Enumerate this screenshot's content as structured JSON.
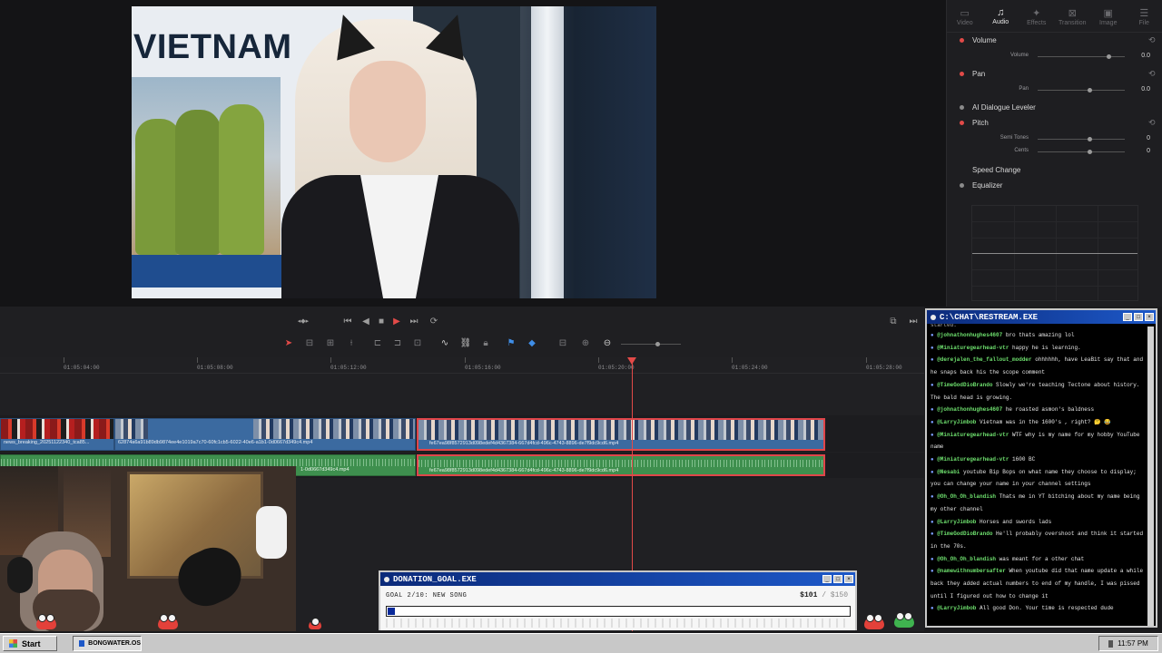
{
  "viewer": {
    "video_title_text": "VIETNAM"
  },
  "inspector": {
    "tabs": [
      {
        "label": "Video",
        "icon": "video-icon"
      },
      {
        "label": "Audio",
        "icon": "music-note-icon"
      },
      {
        "label": "Effects",
        "icon": "effects-icon"
      },
      {
        "label": "Transition",
        "icon": "transition-icon"
      },
      {
        "label": "Image",
        "icon": "image-icon"
      },
      {
        "label": "File",
        "icon": "file-icon"
      }
    ],
    "volume": {
      "title": "Volume",
      "param": "Volume",
      "value": "0.0"
    },
    "pan": {
      "title": "Pan",
      "param": "Pan",
      "value": "0.0"
    },
    "ai_dialogue": {
      "title": "AI Dialogue Leveler"
    },
    "pitch": {
      "title": "Pitch",
      "semi_label": "Semi Tones",
      "semi_value": "0",
      "cents_label": "Cents",
      "cents_value": "0"
    },
    "speed": {
      "title": "Speed Change"
    },
    "equalizer": {
      "title": "Equalizer"
    }
  },
  "timeline": {
    "timecodes": [
      "01:05:04:00",
      "01:05:08:00",
      "01:05:12:00",
      "01:05:16:00",
      "01:05:20:00",
      "01:05:24:00",
      "01:05:28:00"
    ],
    "video_clips": [
      {
        "name": "news_breaking_20251122340_tca85..."
      },
      {
        "name": "62874a6a91b89db9874ee4e1019a7c70-60fc1cb5-6022-40e6-a1b1-0d0667d349c4.mp4"
      },
      {
        "name": "fe67ea98f8572913d098edef4d4367384-667d4fcd-496c-4743-8896-de7f9dc9cd6.mp4"
      }
    ],
    "audio_clips": [
      {
        "name": "1-0d0667d349c4.mp4"
      },
      {
        "name": "fe67ea98f8572913d098edef4d4367384-667d4fcd-496c-4743-8896-de7f9dc9cd6.mp4"
      }
    ]
  },
  "chat": {
    "title": "C:\\CHAT\\RESTREAM.EXE",
    "top_fragment": "started.",
    "messages": [
      {
        "user": "@johnathonhughes4607",
        "text": "bro thats amazing lol"
      },
      {
        "user": "@Miniaturegearhead-vtr",
        "text": "happy he is learning."
      },
      {
        "user": "@derejalen_the_fallout_modder",
        "text": "ohhhhhh, have LeaBit say that and he snaps back his the scope comment"
      },
      {
        "user": "@TimeGodDioBrando",
        "text": "Slowly we're teaching Tectone about history. The bald head is growing."
      },
      {
        "user": "@johnathonhughes4607",
        "text": "he roasted asmon's baldness"
      },
      {
        "user": "@LarryJimbob",
        "text": "Vietnam was in the 1600's , right? 🤔 😂"
      },
      {
        "user": "@Miniaturegearhead-vtr",
        "text": "WTF why is my name for my hobby YouTube name"
      },
      {
        "user": "@Miniaturegearhead-vtr",
        "text": "1600 BC"
      },
      {
        "user": "@Nesabi",
        "text": "youtube Bip Bops on what name they choose to display; you can change your name in your channel settings"
      },
      {
        "user": "@Oh_Oh_Oh_blandish",
        "text": "Thats me in YT bitching about my name being my other channel"
      },
      {
        "user": "@LarryJimbob",
        "text": "Horses and swords lads"
      },
      {
        "user": "@TimeGodDioBrando",
        "text": "He'll probably overshoot and think it started in the 70s."
      },
      {
        "user": "@Oh_Oh_Oh_blandish",
        "text": "was meant for a other chat"
      },
      {
        "user": "@namewithnumbersafter",
        "text": "When youtube did that name update a while back they added actual numbers to end of my handle, I was pissed until I figured out how to change it"
      },
      {
        "user": "@LarryJimbob",
        "text": "All good Don. Your time is respected dude"
      }
    ]
  },
  "donation": {
    "title": "DONATION_GOAL.EXE",
    "goal_text": "GOAL 2/10: NEW SONG",
    "amount": "$101",
    "target": "/ $150",
    "progress": 0.015
  },
  "taskbar": {
    "start_label": "Start",
    "task_label": "BONGWATER.OS",
    "clock": "11:57 PM"
  }
}
